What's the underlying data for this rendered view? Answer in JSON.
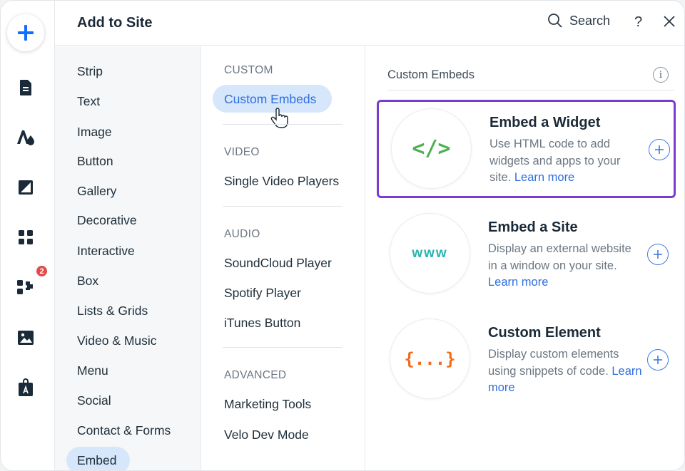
{
  "header": {
    "title": "Add to Site",
    "search_label": "Search",
    "help_label": "?"
  },
  "rail": {
    "icons": [
      "plus-icon",
      "page-icon",
      "theme-icon",
      "background-icon",
      "apps-icon",
      "business-apps-icon",
      "media-icon",
      "portfolio-icon"
    ],
    "badge_count": "2",
    "accent": "#116dff"
  },
  "categories": {
    "items": [
      "Strip",
      "Text",
      "Image",
      "Button",
      "Gallery",
      "Decorative",
      "Interactive",
      "Box",
      "Lists & Grids",
      "Video & Music",
      "Menu",
      "Social",
      "Contact & Forms",
      "Embed"
    ],
    "selected": "Embed"
  },
  "subcategories": {
    "sections": [
      {
        "title": "CUSTOM",
        "items": [
          "Custom Embeds"
        ]
      },
      {
        "title": "VIDEO",
        "items": [
          "Single Video Players"
        ]
      },
      {
        "title": "AUDIO",
        "items": [
          "SoundCloud Player",
          "Spotify Player",
          "iTunes Button"
        ]
      },
      {
        "title": "ADVANCED",
        "items": [
          "Marketing Tools",
          "Velo Dev Mode"
        ]
      }
    ],
    "selected": "Custom Embeds"
  },
  "main": {
    "title": "Custom Embeds",
    "info_glyph": "i",
    "cards": [
      {
        "icon_text": "</>",
        "icon_color": "#4caf50",
        "title": "Embed a Widget",
        "desc": "Use HTML code to add widgets and apps to your site.",
        "link": "Learn more",
        "highlighted": true
      },
      {
        "icon_text": "www",
        "icon_color": "#2bb3b0",
        "title": "Embed a Site",
        "desc": "Display an external website in a window on your site.",
        "link": "Learn more",
        "highlighted": false
      },
      {
        "icon_text": "{...}",
        "icon_color": "#ef6c1a",
        "title": "Custom Element",
        "desc": "Display custom elements using snippets of code.",
        "link": "Learn more",
        "highlighted": false
      }
    ],
    "highlight_color": "#7a3ccf",
    "link_color": "#2f6fe0"
  }
}
